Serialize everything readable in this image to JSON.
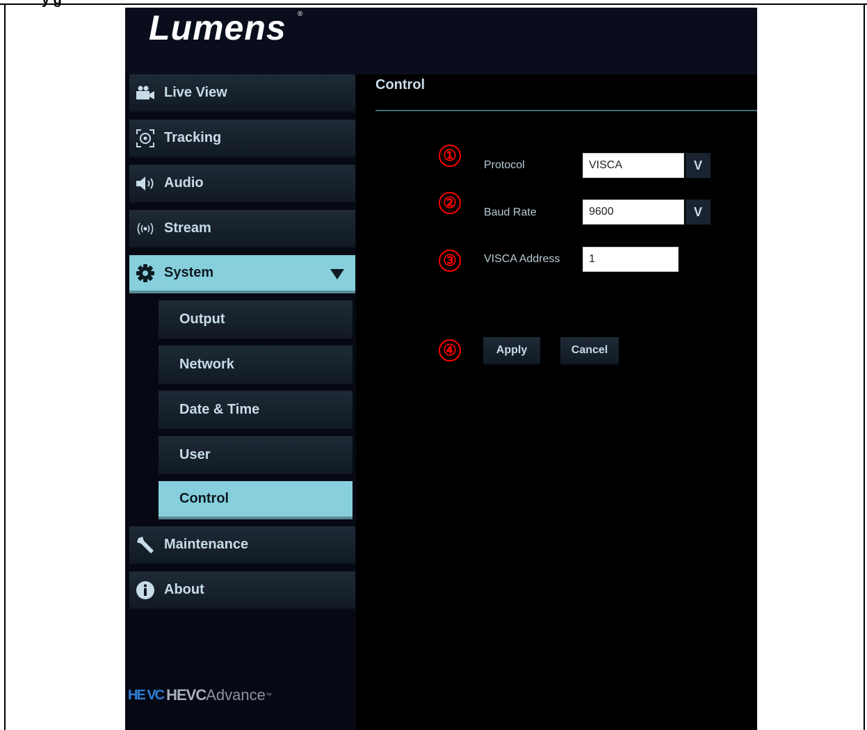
{
  "document": {
    "heading_fragment": "y        g"
  },
  "brand": {
    "logo_text": "Lumens",
    "registered_mark": "®"
  },
  "sidebar": {
    "items": [
      {
        "label": "Live View",
        "icon": "video-camera-icon"
      },
      {
        "label": "Tracking",
        "icon": "tracking-target-icon"
      },
      {
        "label": "Audio",
        "icon": "speaker-icon"
      },
      {
        "label": "Stream",
        "icon": "broadcast-icon"
      },
      {
        "label": "System",
        "icon": "gear-icon",
        "expanded": true
      },
      {
        "label": "Maintenance",
        "icon": "wrench-icon"
      },
      {
        "label": "About",
        "icon": "info-icon"
      }
    ],
    "system_submenu": [
      {
        "label": "Output"
      },
      {
        "label": "Network"
      },
      {
        "label": "Date & Time"
      },
      {
        "label": "User"
      },
      {
        "label": "Control",
        "active": true
      }
    ],
    "footer_logo": {
      "mark": "HE VC",
      "bold": "HEVC",
      "light": "Advance",
      "tm": "™"
    }
  },
  "main": {
    "title": "Control",
    "markers": [
      "①",
      "②",
      "③",
      "④"
    ],
    "fields": {
      "protocol": {
        "label": "Protocol",
        "value": "VISCA",
        "arrow": "V"
      },
      "baud_rate": {
        "label": "Baud Rate",
        "value": "9600",
        "arrow": "V"
      },
      "visca_address": {
        "label": "VISCA Address",
        "value": "1"
      }
    },
    "buttons": {
      "apply": "Apply",
      "cancel": "Cancel"
    }
  },
  "colors": {
    "background": "#000000",
    "active_item": "#87cfdc",
    "nav_text": "#c8dce8",
    "marker": "#ff0000",
    "accent_line": "#3c6d7a"
  }
}
